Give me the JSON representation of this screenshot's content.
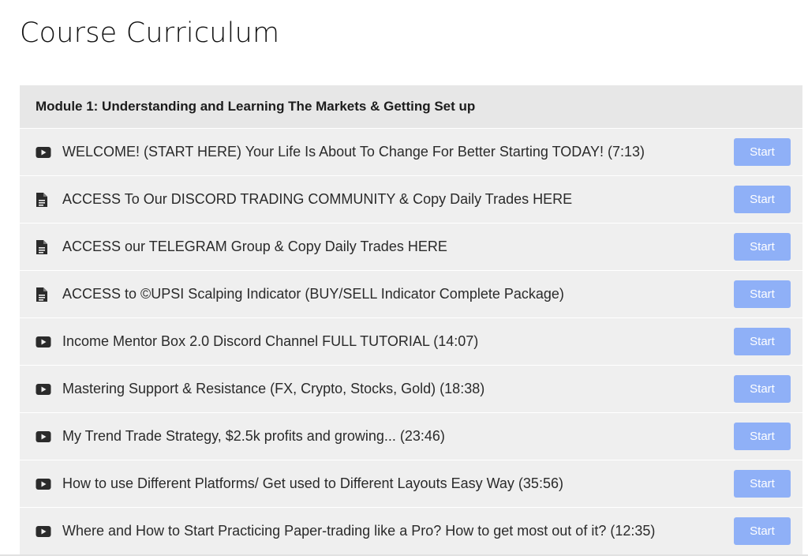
{
  "page": {
    "title": "Course Curriculum"
  },
  "module": {
    "title": "Module 1: Understanding and Learning The Markets & Getting Set up"
  },
  "lectures": [
    {
      "icon": "video-icon",
      "title": "WELCOME! (START HERE) Your Life Is About To Change For Better Starting TODAY! (7:13)",
      "button": "Start"
    },
    {
      "icon": "document-icon",
      "title": "ACCESS To Our DISCORD TRADING COMMUNITY & Copy Daily Trades HERE",
      "button": "Start"
    },
    {
      "icon": "document-icon",
      "title": "ACCESS our TELEGRAM Group & Copy Daily Trades HERE",
      "button": "Start"
    },
    {
      "icon": "document-icon",
      "title": "ACCESS to ©UPSI Scalping Indicator (BUY/SELL Indicator Complete Package)",
      "button": "Start"
    },
    {
      "icon": "video-icon",
      "title": "Income Mentor Box 2.0 Discord Channel FULL TUTORIAL (14:07)",
      "button": "Start"
    },
    {
      "icon": "video-icon",
      "title": "Mastering Support & Resistance (FX, Crypto, Stocks, Gold) (18:38)",
      "button": "Start"
    },
    {
      "icon": "video-icon",
      "title": "My Trend Trade Strategy, $2.5k profits and growing... (23:46)",
      "button": "Start"
    },
    {
      "icon": "video-icon",
      "title": "How to use Different Platforms/ Get used to Different Layouts Easy Way (35:56)",
      "button": "Start"
    },
    {
      "icon": "video-icon",
      "title": "Where and How to Start Practicing Paper-trading like a Pro? How to get most out of it? (12:35)",
      "button": "Start"
    }
  ],
  "colors": {
    "start_button": "#8fb0f7",
    "row_background": "#efefef",
    "module_header_background": "#e7e7e7"
  }
}
